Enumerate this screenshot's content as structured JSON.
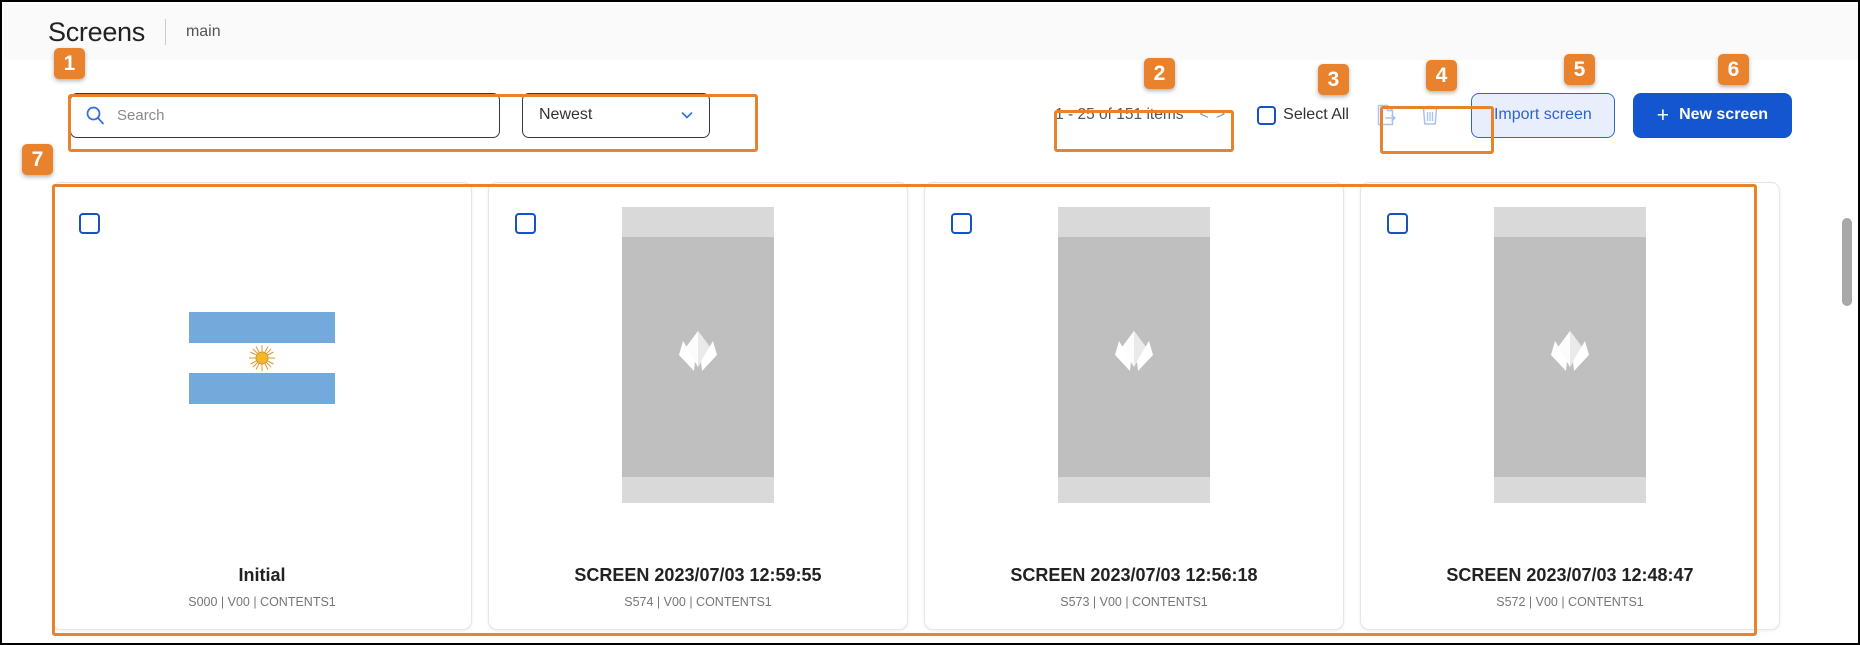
{
  "header": {
    "title": "Screens",
    "branch": "main"
  },
  "toolbar": {
    "search": {
      "placeholder": "Search",
      "value": "",
      "icon": "search-icon"
    },
    "sort": {
      "selected": "Newest",
      "icon": "chevron-down-icon"
    },
    "pagination": {
      "text": "1 - 25 of 151 items",
      "prev": "<",
      "next": ">"
    },
    "select_all": {
      "label": "Select All",
      "checked": false
    },
    "actions": {
      "export_icon": "export-file-icon",
      "delete_icon": "trash-icon"
    },
    "import_button": "Import screen",
    "new_button": {
      "plus": "+",
      "label": "New screen"
    }
  },
  "cards": [
    {
      "title": "Initial",
      "meta": "S000 | V00 | CONTENTS1",
      "thumb_type": "flag",
      "checked": false
    },
    {
      "title": "SCREEN 2023/07/03 12:59:55",
      "meta": "S574 | V00 | CONTENTS1",
      "thumb_type": "placeholder",
      "checked": false
    },
    {
      "title": "SCREEN 2023/07/03 12:56:18",
      "meta": "S573 | V00 | CONTENTS1",
      "thumb_type": "placeholder",
      "checked": false
    },
    {
      "title": "SCREEN 2023/07/03 12:48:47",
      "meta": "S572 | V00 | CONTENTS1",
      "thumb_type": "placeholder",
      "checked": false
    }
  ],
  "annotations": {
    "badges": [
      "1",
      "2",
      "3",
      "4",
      "5",
      "6",
      "7"
    ]
  },
  "colors": {
    "annotation": "#e8822c",
    "primary": "#1456cf",
    "import_bg": "#e8eefc",
    "flag_blue": "#74a9dc",
    "placeholder_gray": "#bfbfbf"
  }
}
